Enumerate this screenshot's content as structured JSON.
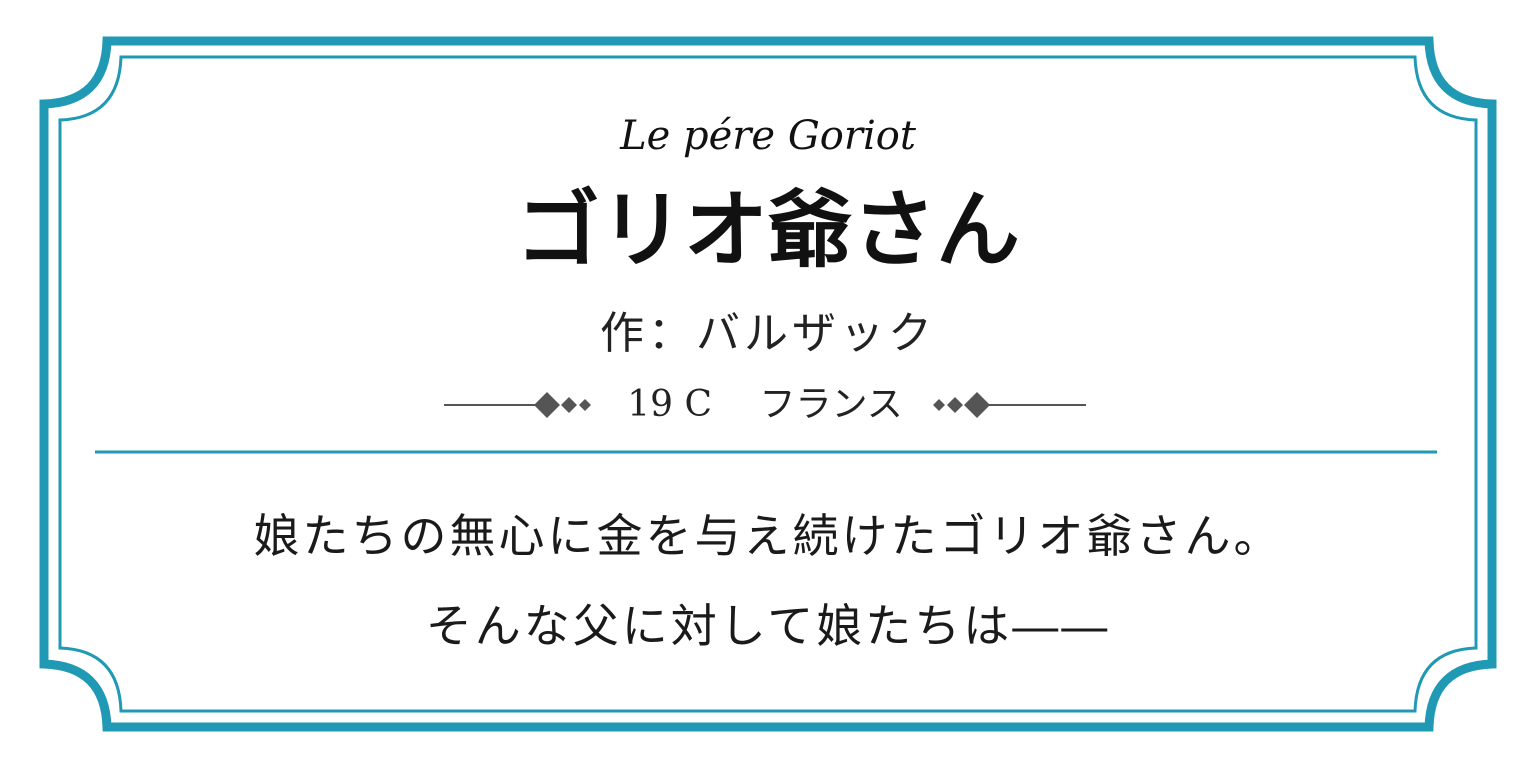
{
  "card": {
    "title_en": "Le pére Goriot",
    "title_jp": "ゴリオ爺さん",
    "author_line": "作：バルザック",
    "era_line": "19 C　 フランス",
    "description": [
      "娘たちの無心に金を与え続けたゴリオ爺さん。",
      "そんな父に対して娘たちは――"
    ]
  },
  "colors": {
    "frame": "#2099b4",
    "ornament": "#555555",
    "text": "#1a1a1a",
    "background": "#ffffff"
  }
}
